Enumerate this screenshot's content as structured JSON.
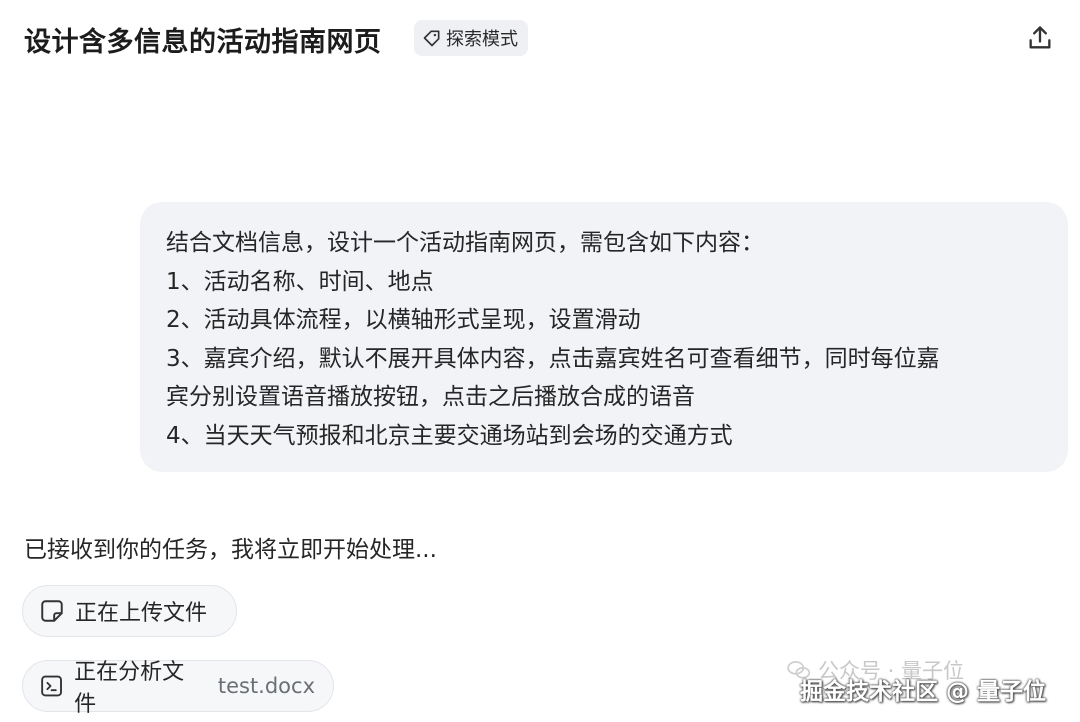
{
  "header": {
    "title": "设计含多信息的活动指南网页",
    "mode_tag": "探索模式",
    "share_icon": "share-upload-icon"
  },
  "user_message": {
    "lines": [
      "结合文档信息，设计一个活动指南网页，需包含如下内容：",
      "1、活动名称、时间、地点",
      "2、活动具体流程，以横轴形式呈现，设置滑动",
      "3、嘉宾介绍，默认不展开具体内容，点击嘉宾姓名可查看细节，同时每位嘉",
      "宾分别设置语音播放按钮，点击之后播放合成的语音",
      "4、当天天气预报和北京主要交通场站到会场的交通方式"
    ]
  },
  "assistant": {
    "reply": "已接收到你的任务，我将立即开始处理...",
    "chips": [
      {
        "icon": "file-upload-icon",
        "label": "正在上传文件",
        "filename": ""
      },
      {
        "icon": "file-analyze-icon",
        "label": "正在分析文件",
        "filename": "test.docx"
      }
    ]
  },
  "watermark": {
    "line1": "公众号 · 量子位",
    "line2": "掘金技术社区 @ 量子位"
  },
  "colors": {
    "bubble_bg": "#f2f3f7",
    "chip_bg": "#f6f7f9",
    "tag_bg": "#eef0f4"
  }
}
